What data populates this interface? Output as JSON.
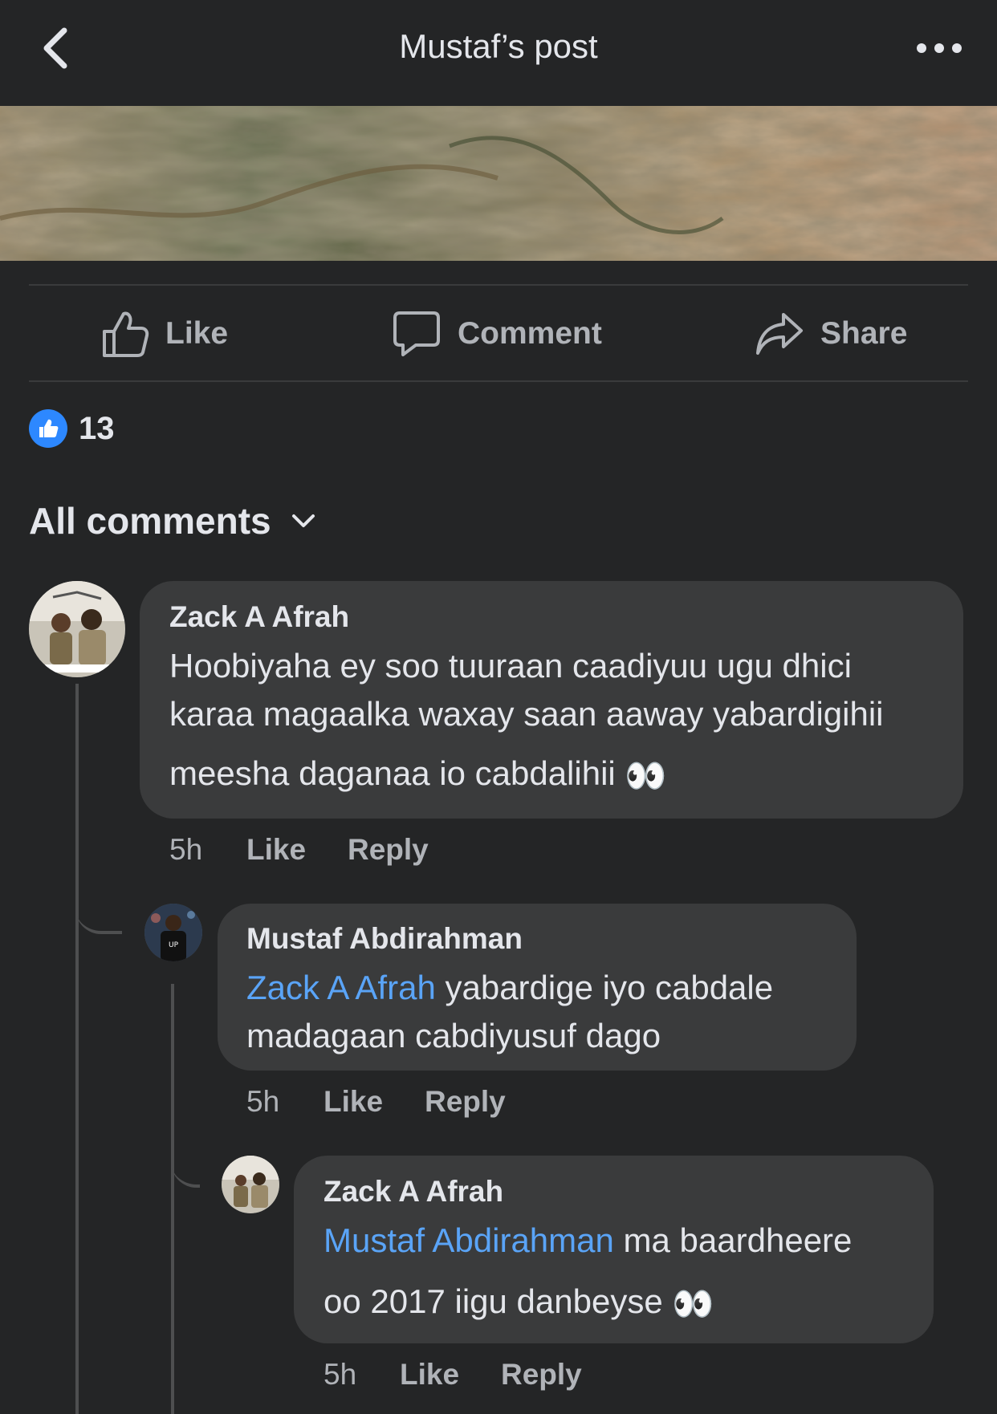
{
  "header": {
    "title": "Mustaf’s post",
    "back_icon": "chevron-left-icon",
    "more_icon": "more-dots-icon"
  },
  "actions": {
    "like_label": "Like",
    "comment_label": "Comment",
    "share_label": "Share"
  },
  "reactions": {
    "count": "13",
    "icon": "thumbs-up-icon",
    "color": "#2d88ff"
  },
  "comments_filter": {
    "label": "All comments",
    "icon": "chevron-down-icon"
  },
  "comments": [
    {
      "author": "Zack A Afrah",
      "lines": [
        "Hoobiyaha ey soo tuuraan caadiyuu ugu dhici",
        "karaa magaalka waxay saan aaway yabardigihii",
        "meesha daganaa io cabdalihii"
      ],
      "emoji": "👀",
      "time": "5h",
      "like_label": "Like",
      "reply_label": "Reply"
    },
    {
      "author": "Mustaf Abdirahman",
      "mention": "Zack A Afrah",
      "line1_rest": " yabardige iyo cabdale",
      "line2": "madagaan cabdiyusuf dago",
      "time": "5h",
      "like_label": "Like",
      "reply_label": "Reply"
    },
    {
      "author": "Zack A Afrah",
      "mention": "Mustaf Abdirahman",
      "line1_rest": " ma baardheere",
      "line2": "oo 2017 iigu danbeyse",
      "emoji": "👀",
      "time": "5h",
      "like_label": "Like",
      "reply_label": "Reply"
    }
  ],
  "colors": {
    "background": "#242526",
    "bubble": "#3a3b3c",
    "mention": "#5aa4f7",
    "secondary_text": "#b0b3b8"
  }
}
